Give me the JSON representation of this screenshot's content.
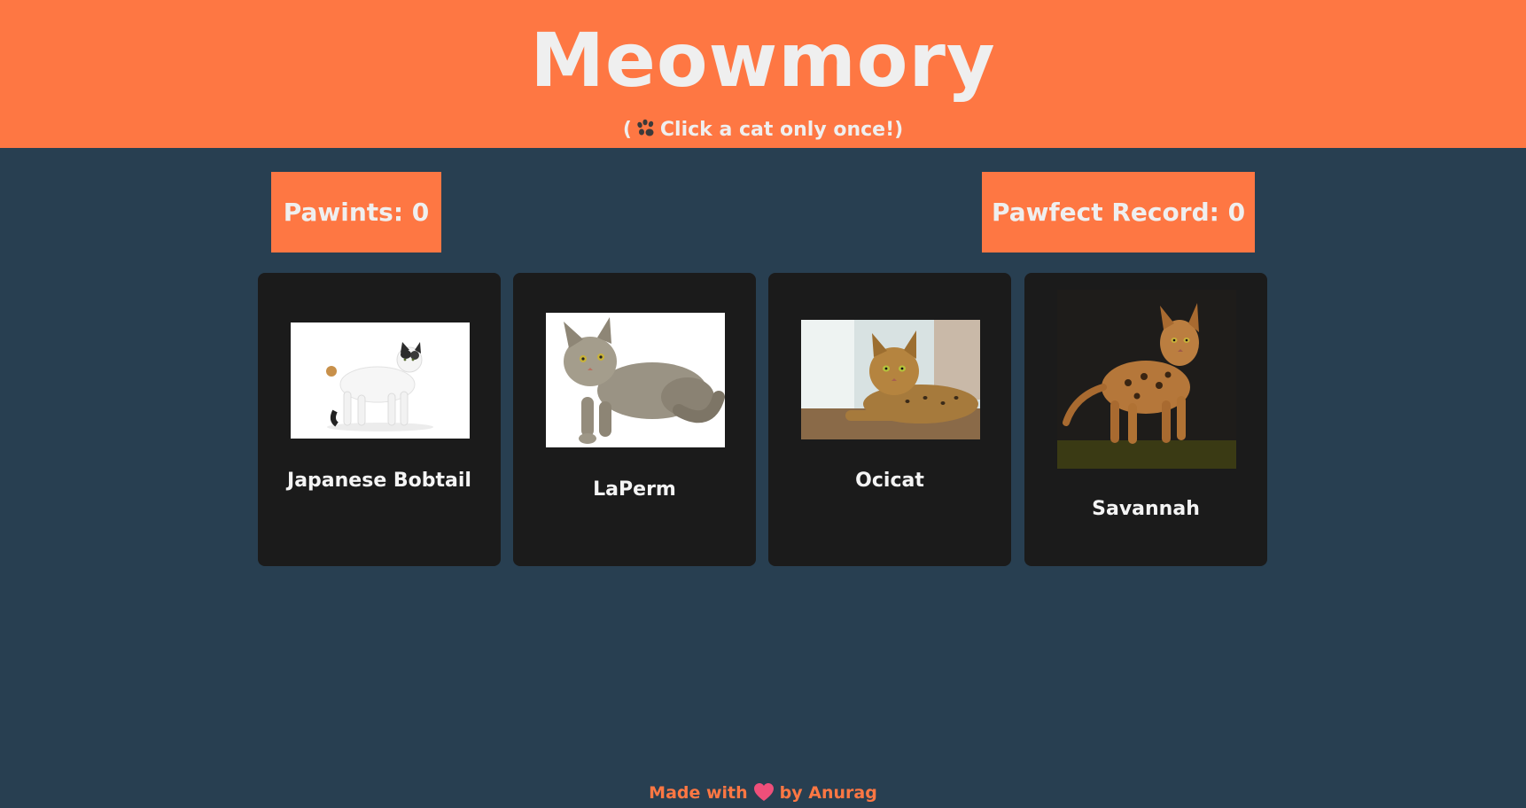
{
  "header": {
    "title": "Meowmory",
    "subtitle_prefix": "(",
    "subtitle_text": "Click a cat only once!)",
    "subtitle_icon": "paw-icon"
  },
  "scores": {
    "current_label": "Pawints: ",
    "current_value": "0",
    "best_label": "Pawfect Record: ",
    "best_value": "0"
  },
  "cards": [
    {
      "name": "Japanese Bobtail",
      "image": "japanese-bobtail-cat"
    },
    {
      "name": "LaPerm",
      "image": "laperm-cat"
    },
    {
      "name": "Ocicat",
      "image": "ocicat-cat"
    },
    {
      "name": "Savannah",
      "image": "savannah-cat"
    }
  ],
  "footer": {
    "prefix": "Made with",
    "icon": "heart-icon",
    "suffix": "by Anurag"
  },
  "colors": {
    "accent": "#fe7743",
    "background": "#283f51",
    "card": "#1b1b1b",
    "text": "#efefef"
  }
}
